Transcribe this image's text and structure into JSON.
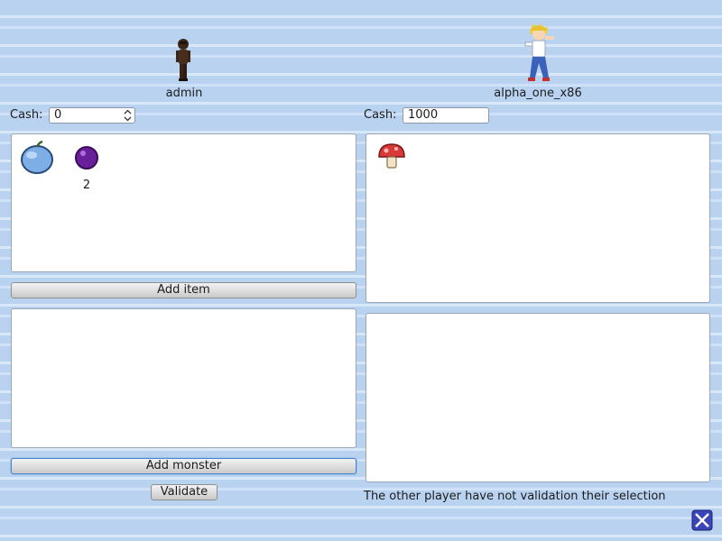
{
  "player_left": {
    "name": "admin",
    "cash_label": "Cash:",
    "cash_value": "0",
    "avatar_icon": "dark-skinned-character-sprite"
  },
  "player_right": {
    "name": "alpha_one_x86",
    "cash_label": "Cash:",
    "cash_value": "1000",
    "avatar_icon": "blond-trainer-character-sprite"
  },
  "left_items": [
    {
      "icon": "blue-apple-icon",
      "count": ""
    },
    {
      "icon": "purple-orb-icon",
      "count": "2"
    }
  ],
  "right_items": [
    {
      "icon": "red-mushroom-icon",
      "count": ""
    }
  ],
  "buttons": {
    "add_item": "Add item",
    "add_monster": "Add monster",
    "validate": "Validate"
  },
  "status_text": "The other player have not validation their selection",
  "close_icon": "close-icon"
}
